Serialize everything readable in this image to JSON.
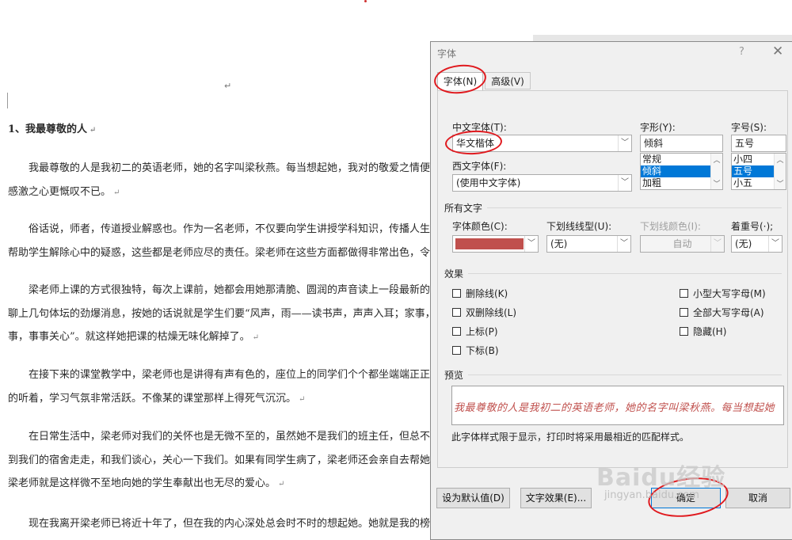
{
  "document": {
    "heading": "1、我最尊敬的人",
    "lines": [
      "我最尊敬的人是我初二的英语老师，她的名字叫梁秋燕。每当想起她，我对的敬爱之情便油然而生",
      "感激之心更慨叹不已。",
      "俗话说，师者，传道授业解惑也。作为一名老师，不仅要向学生讲授学科知识，传播人生道理，还",
      "帮助学生解除心中的疑惑，这些都是老师应尽的责任。梁老师在这些方面都做得非常出色，令我十分敬佩",
      "梁老师上课的方式很独特，每次上课前，她都会用她那清脆、圆润的声音读上一段最新的社会新闻",
      "聊上几句体坛的劲爆消息，按她的话说就是学生们要“风声，雨——读书声，声声入耳；家事，国事，天",
      "事，事事关心”。就这样她把课的枯燥无味化解掉了。",
      "在接下来的课堂教学中，梁老师也是讲得有声有色的，座位上的同学们个个都坐端端正正，认认真",
      "的听着，学习气氛非常活跃。不像某的课堂那样上得死气沉沉。",
      "在日常生活中，梁老师对我们的关怀也是无微不至的，虽然她不是我们的班主任，但总不忘每个星",
      "到我们的宿舍走走，和我们谈心，关心一下我们。如果有同学生病了，梁老师还会亲自去帮她买药给她吃",
      "梁老师就是这样微不至地向她的学生奉献出也无尽的爱心。",
      "现在我离开梁老师已将近十年了，但在我的内心深处总会时不时的想起她。她就是我的榜样，我将会"
    ]
  },
  "dialog": {
    "title": "字体",
    "help": "?",
    "close": "✕",
    "tabs": [
      "字体(N)",
      "高级(V)"
    ],
    "font_section": {
      "chinese_font_label": "中文字体(T):",
      "chinese_font_value": "华文楷体",
      "western_font_label": "西文字体(F):",
      "western_font_value": "(使用中文字体)",
      "style_label": "字形(Y):",
      "style_value": "倾斜",
      "style_options": [
        "常规",
        "倾斜",
        "加粗"
      ],
      "style_selected_index": 1,
      "size_label": "字号(S):",
      "size_value": "五号",
      "size_options": [
        "小四",
        "五号",
        "小五"
      ],
      "size_selected_index": 1
    },
    "all_text": {
      "section_label": "所有文字",
      "color_label": "字体颜色(C):",
      "color_value": "#c0504d",
      "underline_style_label": "下划线线型(U):",
      "underline_style_value": "(无)",
      "underline_color_label": "下划线颜色(I):",
      "underline_color_value": "自动",
      "emphasis_label": "着重号(·);",
      "emphasis_value": "(无)"
    },
    "effects": {
      "section_label": "效果",
      "left": [
        "删除线(K)",
        "双删除线(L)",
        "上标(P)",
        "下标(B)"
      ],
      "right": [
        "小型大写字母(M)",
        "全部大写字母(A)",
        "隐藏(H)"
      ]
    },
    "preview": {
      "section_label": "预览",
      "text": "我最尊敬的人是我初二的英语老师，她的名字叫梁秋燕。每当想起她",
      "note": "此字体样式限于显示，打印时将采用最相近的匹配样式。"
    },
    "buttons": {
      "set_default": "设为默认值(D)",
      "text_effects": "文字效果(E)...",
      "ok": "确定",
      "cancel": "取消"
    }
  },
  "watermark": {
    "logo": "Baidu经验",
    "url": "jingyan.baidu.com"
  },
  "colors": {
    "font_color": "#c0504d",
    "selection": "#0078d7",
    "annotation": "#e0191e"
  }
}
